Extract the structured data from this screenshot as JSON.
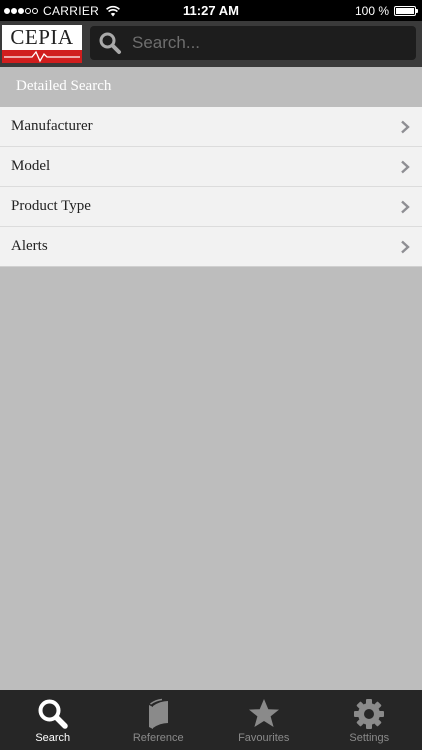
{
  "status_bar": {
    "carrier": "CARRIER",
    "time": "11:27 AM",
    "battery": "100 %",
    "battery_level": 1.0,
    "signal_bars_filled": 3,
    "signal_bars_total": 5
  },
  "header": {
    "logo_text": "CEPIA",
    "search_placeholder": "Search...",
    "search_value": ""
  },
  "section": {
    "title": "Detailed Search"
  },
  "list": {
    "items": [
      {
        "label": "Manufacturer",
        "icon": "chevron-right-icon"
      },
      {
        "label": "Model",
        "icon": "chevron-right-icon"
      },
      {
        "label": "Product Type",
        "icon": "chevron-right-icon"
      },
      {
        "label": "Alerts",
        "icon": "chevron-right-icon"
      }
    ]
  },
  "tab_bar": {
    "tabs": [
      {
        "label": "Search",
        "icon": "search-icon",
        "active": true
      },
      {
        "label": "Reference",
        "icon": "book-icon",
        "active": false
      },
      {
        "label": "Favourites",
        "icon": "star-icon",
        "active": false
      },
      {
        "label": "Settings",
        "icon": "gear-icon",
        "active": false
      }
    ]
  },
  "colors": {
    "background": "#bdbdbd",
    "header": "#3a3a3a",
    "logo_red": "#d11e1e",
    "tab_bar": "#262626",
    "tab_active": "#ffffff",
    "tab_inactive": "#8a8a8a"
  }
}
